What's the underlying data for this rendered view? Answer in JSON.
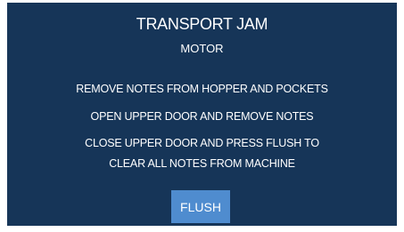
{
  "alert": {
    "title": "TRANSPORT JAM",
    "subtitle": "MOTOR",
    "instructions": [
      "REMOVE NOTES FROM  HOPPER AND POCKETS",
      "OPEN UPPER DOOR AND REMOVE NOTES",
      "CLOSE UPPER DOOR AND PRESS FLUSH TO",
      "CLEAR ALL NOTES FROM MACHINE"
    ],
    "flush_label": "FLUSH"
  },
  "colors": {
    "background": "#163558",
    "button": "#4f8ccf",
    "text": "#ffffff"
  }
}
